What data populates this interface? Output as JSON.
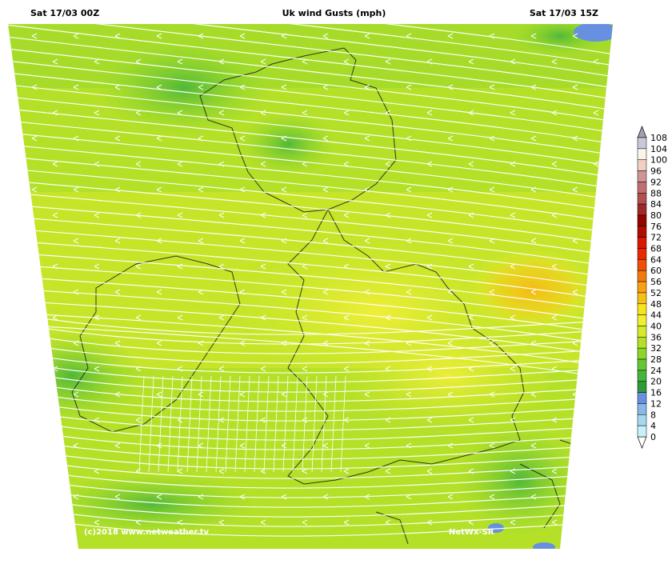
{
  "header": {
    "left": "Sat 17/03 00Z",
    "title": "Uk wind Gusts (mph)",
    "right": "Sat 17/03 15Z"
  },
  "credits": {
    "left": "(c)2018 www.netweather.tv",
    "right": "NetWx-SR"
  },
  "legend": {
    "levels": [
      {
        "value": "0",
        "color": "#c8f0f8"
      },
      {
        "value": "4",
        "color": "#a8d8f0"
      },
      {
        "value": "8",
        "color": "#88b8e8"
      },
      {
        "value": "12",
        "color": "#6890e0"
      },
      {
        "value": "16",
        "color": "#2e9a3a"
      },
      {
        "value": "20",
        "color": "#46b43a"
      },
      {
        "value": "24",
        "color": "#64c832"
      },
      {
        "value": "28",
        "color": "#8cd62c"
      },
      {
        "value": "32",
        "color": "#b4e028"
      },
      {
        "value": "36",
        "color": "#d6ea2a"
      },
      {
        "value": "40",
        "color": "#f0f030"
      },
      {
        "value": "44",
        "color": "#f8e41c"
      },
      {
        "value": "48",
        "color": "#f8c014"
      },
      {
        "value": "52",
        "color": "#f8a010"
      },
      {
        "value": "56",
        "color": "#f27a0c"
      },
      {
        "value": "60",
        "color": "#ee5008"
      },
      {
        "value": "64",
        "color": "#e82804"
      },
      {
        "value": "68",
        "color": "#d81800"
      },
      {
        "value": "72",
        "color": "#b00c00"
      },
      {
        "value": "76",
        "color": "#940400"
      },
      {
        "value": "80",
        "color": "#a02828"
      },
      {
        "value": "84",
        "color": "#b05050"
      },
      {
        "value": "88",
        "color": "#c07070"
      },
      {
        "value": "92",
        "color": "#d09494"
      },
      {
        "value": "96",
        "color": "#f0d0c0"
      },
      {
        "value": "100",
        "color": "#fcf4e8"
      },
      {
        "value": "104",
        "color": "#c8c8d8"
      },
      {
        "value": "108",
        "color": "#a0a0b0"
      }
    ]
  },
  "colors": {
    "background_field": "#b4e028",
    "streamline": "#ffffff",
    "coastline": "#1a1a1a"
  }
}
